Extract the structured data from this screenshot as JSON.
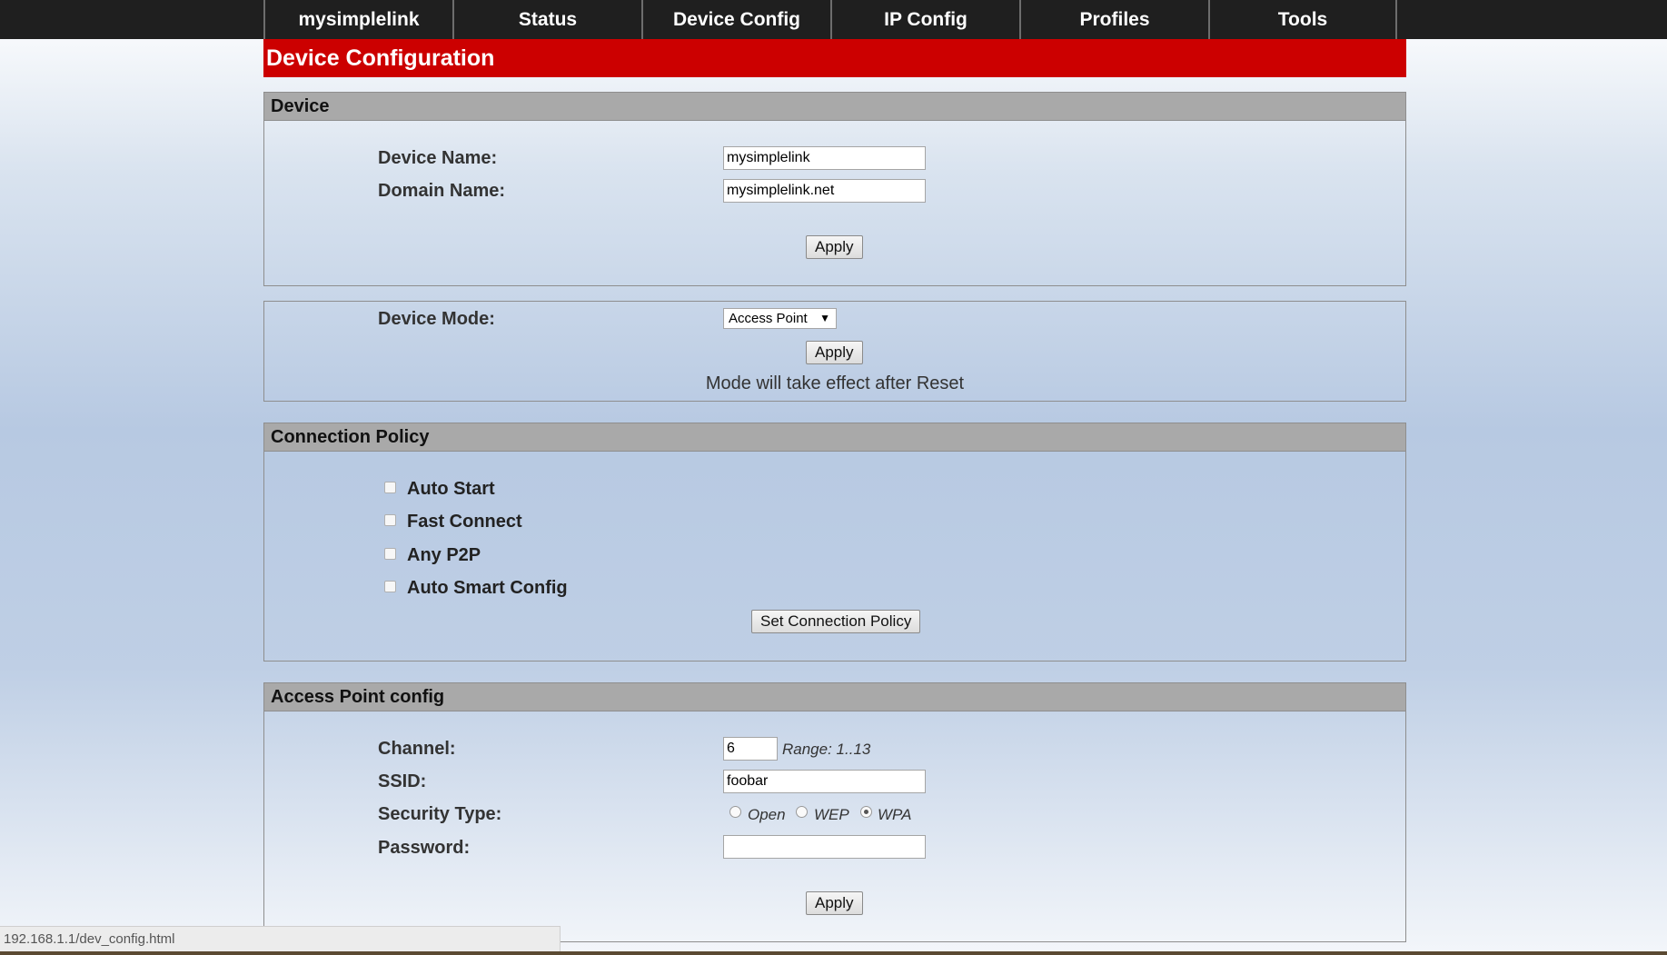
{
  "nav": {
    "tabs": [
      {
        "label": "mysimplelink"
      },
      {
        "label": "Status"
      },
      {
        "label": "Device Config"
      },
      {
        "label": "IP Config"
      },
      {
        "label": "Profiles"
      },
      {
        "label": "Tools"
      }
    ]
  },
  "page_title": "Device Configuration",
  "device_section": {
    "header": "Device",
    "device_name_label": "Device Name:",
    "device_name_value": "mysimplelink",
    "domain_name_label": "Domain Name:",
    "domain_name_value": "mysimplelink.net",
    "apply_label": "Apply"
  },
  "mode_section": {
    "device_mode_label": "Device Mode:",
    "device_mode_value": "Access Point",
    "apply_label": "Apply",
    "note": "Mode will take effect after Reset"
  },
  "connection_policy": {
    "header": "Connection Policy",
    "options": [
      {
        "label": "Auto Start",
        "checked": false
      },
      {
        "label": "Fast Connect",
        "checked": false
      },
      {
        "label": "Any P2P",
        "checked": false
      },
      {
        "label": "Auto Smart Config",
        "checked": false
      }
    ],
    "set_button_label": "Set Connection Policy"
  },
  "ap_config": {
    "header": "Access Point config",
    "channel_label": "Channel:",
    "channel_value": "6",
    "channel_range": "Range: 1..13",
    "ssid_label": "SSID:",
    "ssid_value": "foobar",
    "security_type_label": "Security Type:",
    "security_options": [
      {
        "label": "Open",
        "selected": false
      },
      {
        "label": "WEP",
        "selected": false
      },
      {
        "label": "WPA",
        "selected": true
      }
    ],
    "password_label": "Password:",
    "password_value": "",
    "apply_label": "Apply"
  },
  "status_bar": {
    "url": "192.168.1.1/dev_config.html"
  }
}
